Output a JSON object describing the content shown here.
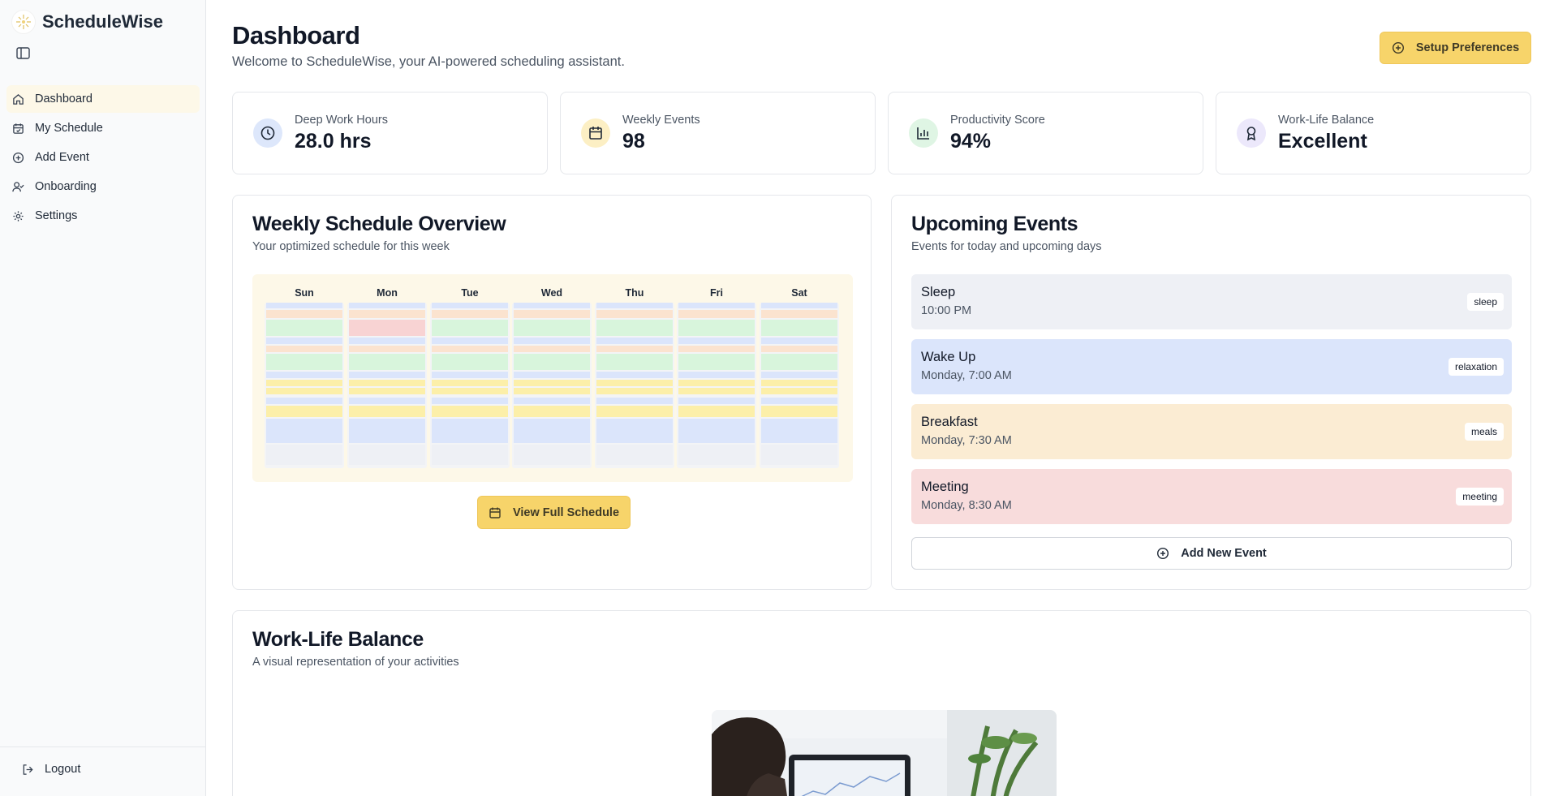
{
  "app": {
    "name": "ScheduleWise"
  },
  "sidebar": {
    "items": [
      {
        "label": "Dashboard",
        "icon": "home-icon",
        "active": true
      },
      {
        "label": "My Schedule",
        "icon": "calendar-check-icon"
      },
      {
        "label": "Add Event",
        "icon": "plus-circle-icon"
      },
      {
        "label": "Onboarding",
        "icon": "user-check-icon"
      },
      {
        "label": "Settings",
        "icon": "gear-icon"
      }
    ],
    "logout_label": "Logout"
  },
  "header": {
    "title": "Dashboard",
    "subtitle": "Welcome to ScheduleWise, your AI-powered scheduling assistant.",
    "setup_button": "Setup Preferences"
  },
  "stats": [
    {
      "label": "Deep Work Hours",
      "value": "28.0 hrs",
      "icon": "clock-icon",
      "color": "#dde7fb"
    },
    {
      "label": "Weekly Events",
      "value": "98",
      "icon": "calendar-icon",
      "color": "#fcefc4"
    },
    {
      "label": "Productivity Score",
      "value": "94%",
      "icon": "bar-chart-icon",
      "color": "#dff5e4"
    },
    {
      "label": "Work-Life Balance",
      "value": "Excellent",
      "icon": "award-icon",
      "color": "#ece8fb"
    }
  ],
  "weekly": {
    "title": "Weekly Schedule Overview",
    "subtitle": "Your optimized schedule for this week",
    "days": [
      "Sun",
      "Mon",
      "Tue",
      "Wed",
      "Thu",
      "Fri",
      "Sat"
    ],
    "view_button": "View Full Schedule"
  },
  "upcoming": {
    "title": "Upcoming Events",
    "subtitle": "Events for today and upcoming days",
    "events": [
      {
        "title": "Sleep",
        "time": "10:00 PM",
        "tag": "sleep",
        "color": "#eef0f5"
      },
      {
        "title": "Wake Up",
        "time": "Monday, 7:00 AM",
        "tag": "relaxation",
        "color": "#dbe5fb"
      },
      {
        "title": "Breakfast",
        "time": "Monday, 7:30 AM",
        "tag": "meals",
        "color": "#fbecd3"
      },
      {
        "title": "Meeting",
        "time": "Monday, 8:30 AM",
        "tag": "meeting",
        "color": "#f8dcdc"
      }
    ],
    "add_button": "Add New Event"
  },
  "balance": {
    "title": "Work-Life Balance",
    "subtitle": "A visual representation of your activities"
  },
  "colors": {
    "accent": "#f7d46a",
    "sleep": "#dbe5fb",
    "meals": "#fbe3cf",
    "meeting": "#f8d3d3",
    "exercise": "#d8f5dc",
    "work": "#fcefa9",
    "free": "#eef0f5"
  }
}
